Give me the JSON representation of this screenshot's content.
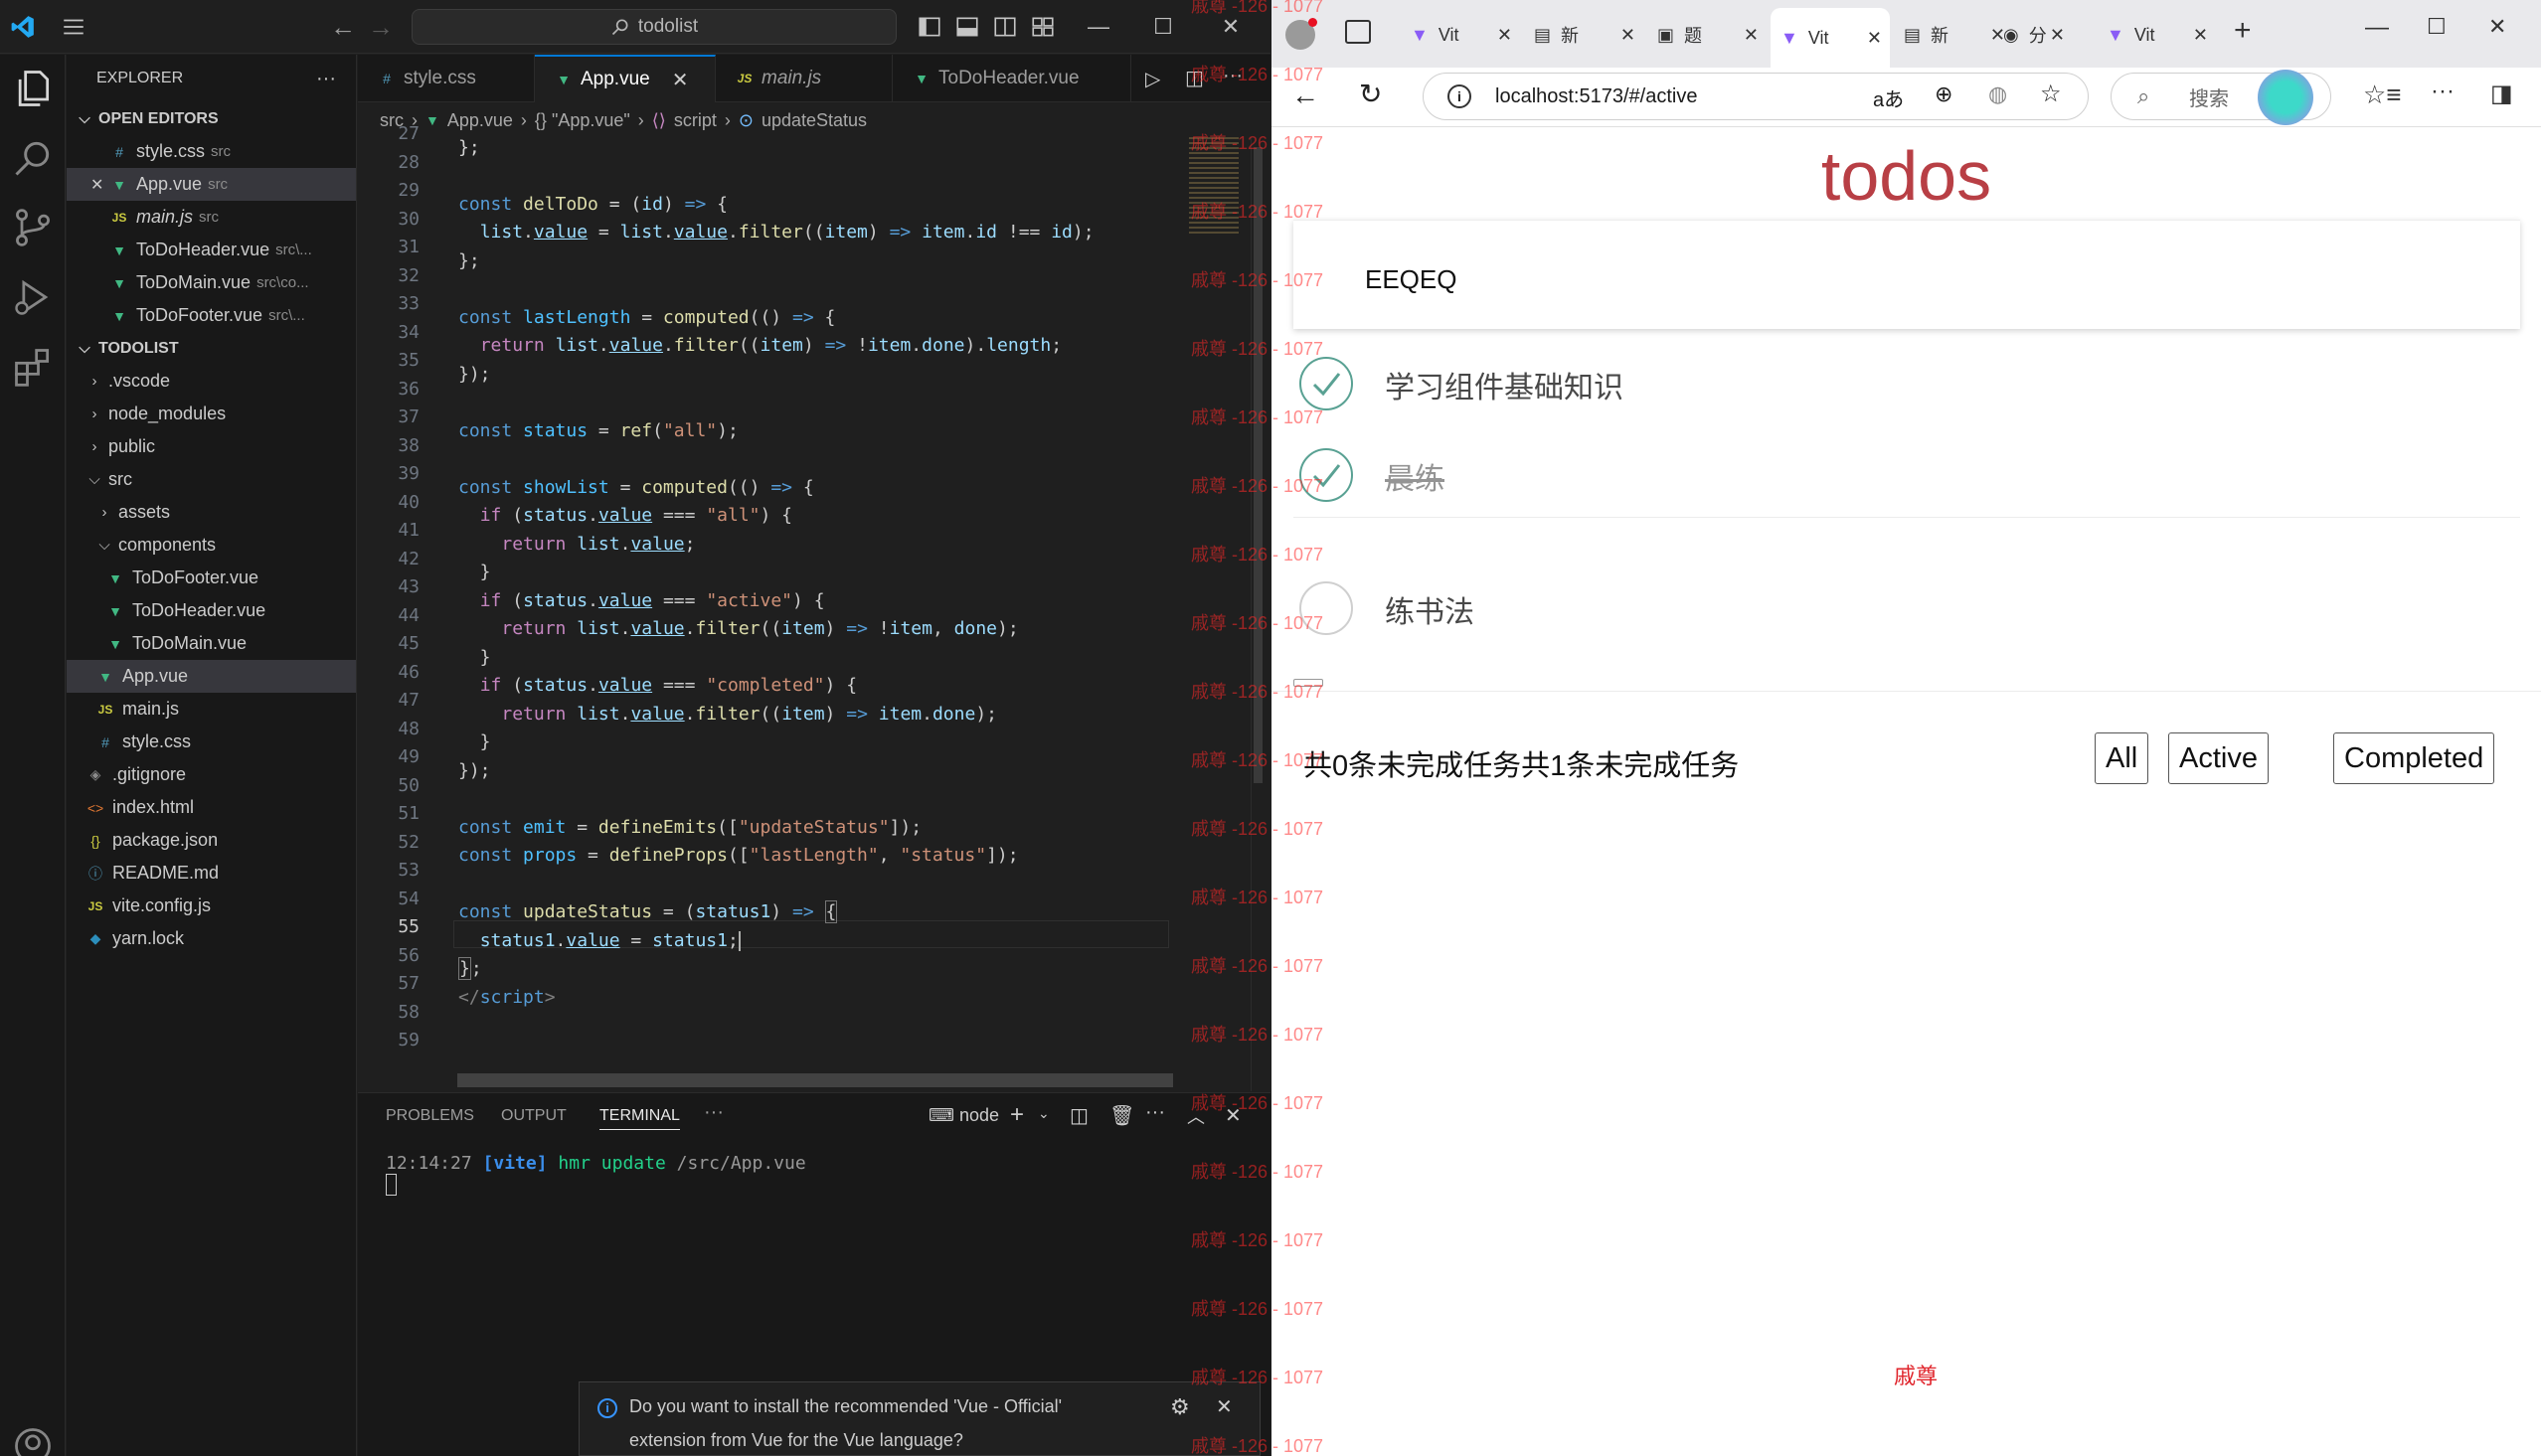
{
  "vscode": {
    "search_label": "todolist",
    "explorer_title": "EXPLORER",
    "open_editors_title": "OPEN EDITORS",
    "open_editors": [
      {
        "name": "style.css",
        "path": "src",
        "type": "css"
      },
      {
        "name": "App.vue",
        "path": "src",
        "type": "vue"
      },
      {
        "name": "main.js",
        "path": "src",
        "type": "js"
      },
      {
        "name": "ToDoHeader.vue",
        "path": "src\\...",
        "type": "vue"
      },
      {
        "name": "ToDoMain.vue",
        "path": "src\\co...",
        "type": "vue"
      },
      {
        "name": "ToDoFooter.vue",
        "path": "src\\...",
        "type": "vue"
      }
    ],
    "project_title": "TODOLIST",
    "tree": [
      {
        "name": ".vscode",
        "type": "folder"
      },
      {
        "name": "node_modules",
        "type": "folder"
      },
      {
        "name": "public",
        "type": "folder"
      },
      {
        "name": "src",
        "type": "folder-open"
      },
      {
        "name": "assets",
        "type": "folder"
      },
      {
        "name": "components",
        "type": "folder-open"
      },
      {
        "name": "ToDoFooter.vue",
        "type": "vue"
      },
      {
        "name": "ToDoHeader.vue",
        "type": "vue"
      },
      {
        "name": "ToDoMain.vue",
        "type": "vue"
      },
      {
        "name": "App.vue",
        "type": "vue"
      },
      {
        "name": "main.js",
        "type": "js"
      },
      {
        "name": "style.css",
        "type": "css"
      },
      {
        "name": ".gitignore",
        "type": "git"
      },
      {
        "name": "index.html",
        "type": "html"
      },
      {
        "name": "package.json",
        "type": "json"
      },
      {
        "name": "README.md",
        "type": "info"
      },
      {
        "name": "vite.config.js",
        "type": "js"
      },
      {
        "name": "yarn.lock",
        "type": "yarn"
      }
    ],
    "tabs": [
      {
        "label": "style.css",
        "type": "css"
      },
      {
        "label": "App.vue",
        "type": "vue"
      },
      {
        "label": "main.js",
        "type": "js"
      },
      {
        "label": "ToDoHeader.vue",
        "type": "vue"
      }
    ],
    "breadcrumb": [
      "src",
      "App.vue",
      "{} \"App.vue\"",
      "script",
      "updateStatus"
    ],
    "line_numbers": [
      "27",
      "28",
      "29",
      "30",
      "31",
      "32",
      "33",
      "34",
      "35",
      "36",
      "37",
      "38",
      "39",
      "40",
      "41",
      "42",
      "43",
      "44",
      "45",
      "46",
      "47",
      "48",
      "49",
      "50",
      "51",
      "52",
      "53",
      "54",
      "55",
      "56",
      "57",
      "58",
      "59"
    ],
    "current_line": "55",
    "panel_tabs": [
      "PROBLEMS",
      "OUTPUT",
      "TERMINAL"
    ],
    "terminal_shell": "node",
    "terminal_time": "12:14:27",
    "terminal_tag": "[vite]",
    "terminal_msg": "hmr update",
    "terminal_path": "/src/App.vue",
    "toast_line1": "Do you want to install the recommended 'Vue - Official'",
    "toast_line2": "extension from Vue for the Vue language?"
  },
  "watermark_text": "戚尊 -126 - 1077",
  "browser": {
    "tabs": [
      "Vit",
      "新",
      "题",
      "Vit",
      "新",
      "分",
      "Vit"
    ],
    "active_tab": 3,
    "url": "localhost:5173/#/active",
    "search_placeholder": "搜索",
    "page": {
      "title": "todos",
      "new_todo_value": "EEQEQ",
      "items": [
        {
          "text": "学习组件基础知识",
          "done": true,
          "strike": false
        },
        {
          "text": "晨练",
          "done": true,
          "strike": true
        },
        {
          "text": "练书法",
          "done": false,
          "strike": false
        }
      ],
      "footer_count": "共0条未完成任务共1条未完成任务",
      "filters": [
        "All",
        "Active",
        "Completed"
      ],
      "signature": "戚尊"
    }
  },
  "colors": {
    "accent": "#0078d4",
    "todo_red": "#b83f45",
    "check_green": "#59a193",
    "vue_green": "#41b883"
  }
}
